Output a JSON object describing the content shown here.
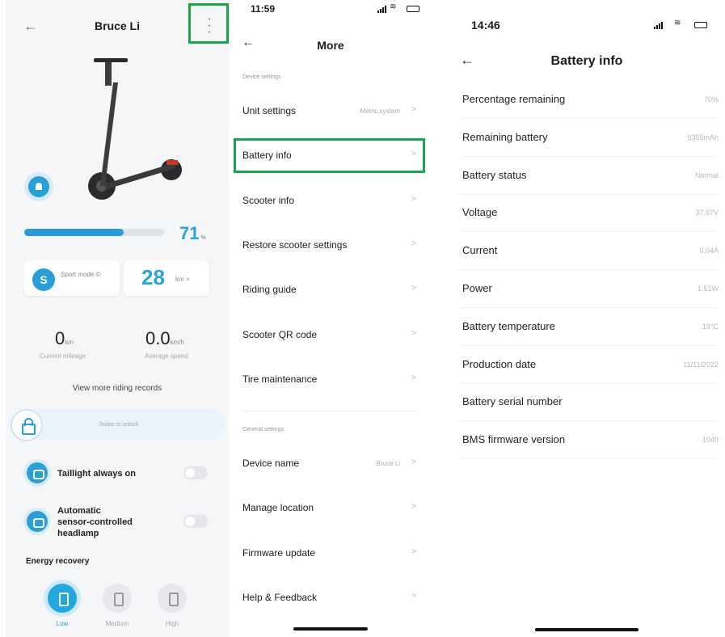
{
  "screen1": {
    "back_icon": "back-arrow-icon",
    "user_name": "Bruce Li",
    "more_icon": "more-vertical-icon",
    "battery_percent": 71,
    "battery_percent_text": "71",
    "battery_unit": "%",
    "mode_badge": "S",
    "mode_label": "Sport mode ©",
    "speed_value": "28",
    "speed_unit": "km >",
    "mileage_value": "0",
    "mileage_unit": "km",
    "mileage_label": "Current mileage",
    "avg_speed_value": "0.0",
    "avg_speed_unit": "km/h",
    "avg_speed_label": "Average speed",
    "view_records": "View more riding records",
    "lock_text": "Swipe to unlock",
    "taillight_label": "Taillight always on",
    "headlamp_label_1": "Automatic",
    "headlamp_label_2": "sensor-controlled",
    "headlamp_label_3": "headlamp",
    "energy_section": "Energy recovery",
    "energy_options": [
      "Low",
      "Medium",
      "High"
    ],
    "accent_color": "#2a9fd6"
  },
  "screen2": {
    "status_time": "11:59",
    "title": "More",
    "device_settings_label": "Device settings",
    "general_settings_label": "General settings",
    "items_device": [
      {
        "label": "Unit settings",
        "value": "Metric system"
      },
      {
        "label": "Battery info",
        "value": ""
      },
      {
        "label": "Scooter info",
        "value": ""
      },
      {
        "label": "Restore scooter settings",
        "value": ""
      },
      {
        "label": "Riding guide",
        "value": ""
      },
      {
        "label": "Scooter QR code",
        "value": ""
      },
      {
        "label": "Tire maintenance",
        "value": ""
      }
    ],
    "items_general": [
      {
        "label": "Device name",
        "value": "Bruce Li"
      },
      {
        "label": "Manage location",
        "value": ""
      },
      {
        "label": "Firmware update",
        "value": ""
      },
      {
        "label": "Help & Feedback",
        "value": ""
      }
    ],
    "chevron": ">"
  },
  "screen3": {
    "status_time": "14:46",
    "title": "Battery info",
    "rows": [
      {
        "label": "Percentage remaining",
        "value": "70%"
      },
      {
        "label": "Remaining battery",
        "value": "5355mAh"
      },
      {
        "label": "Battery status",
        "value": "Normal"
      },
      {
        "label": "Voltage",
        "value": "37.97V"
      },
      {
        "label": "Current",
        "value": "0.04A"
      },
      {
        "label": "Power",
        "value": "1.51W"
      },
      {
        "label": "Battery temperature",
        "value": "19°C"
      },
      {
        "label": "Production date",
        "value": "11/11/2022"
      },
      {
        "label": "Battery serial number",
        "value": ""
      },
      {
        "label": "BMS firmware version",
        "value": "1040"
      }
    ]
  },
  "highlight_color": "#1aa64a"
}
